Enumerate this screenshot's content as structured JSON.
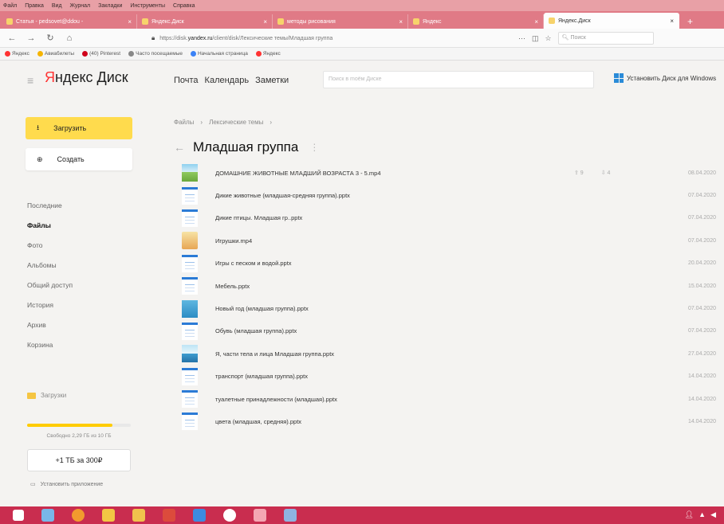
{
  "browser": {
    "menu": [
      "Файл",
      "Правка",
      "Вид",
      "Журнал",
      "Закладки",
      "Инструменты",
      "Справка"
    ],
    "tabs": [
      {
        "title": "Статья - pedsovet@ddou - ",
        "active": false
      },
      {
        "title": "Яндекс.Диск",
        "active": false
      },
      {
        "title": "методы рисования ",
        "active": false
      },
      {
        "title": "Яндекс",
        "active": false
      },
      {
        "title": "Яндекс.Диск",
        "active": true
      }
    ],
    "url_prefix": "https://disk.",
    "url_domain": "yandex.ru",
    "url_path": "/client/disk/Лексические темы/Младшая группа",
    "search_placeholder": "Поиск",
    "bookmarks": [
      "Яндекс",
      "Авиабилеты",
      "(40) Pinterest",
      "Часто посещаемые",
      "Начальная страница",
      "Яндекс"
    ]
  },
  "yandex": {
    "logo_red": "Я",
    "logo_rest": "ндекс Диск",
    "nav": [
      "Почта",
      "Календарь",
      "Заметки"
    ],
    "search_placeholder": "Поиск в moём Диске",
    "install_label": "Установить Диск для Windows"
  },
  "sidebar": {
    "upload": "Загрузить",
    "create": "Создать",
    "items": [
      "Последние",
      "Файлы",
      "Фото",
      "Альбомы",
      "Общий доступ",
      "История",
      "Архив",
      "Корзина"
    ],
    "active": "Файлы",
    "downloads": "Загрузки",
    "storage_fraction": 0.82,
    "storage_text": "Свободно 2,29 ГБ из 10 ГБ",
    "buy": "+1 ТБ за 300₽",
    "install_app": "Установить приложение"
  },
  "breadcrumb": [
    "Файлы",
    "Лексические темы"
  ],
  "page_title": "Младшая группа",
  "files": [
    {
      "name": "ДОМАШНИЕ ЖИВОТНЫЕ МЛАДШИЙ ВОЗРАСТА 3 - 5.mp4",
      "date": "08.04.2020",
      "thumb": "img-a",
      "meta": [
        "⇪ 9",
        "⇩ 4"
      ]
    },
    {
      "name": "Дикие животные (младшая-средняя группа).pptx",
      "date": "07.04.2020",
      "thumb": "doc"
    },
    {
      "name": "Дикие птицы. Младшая гр..pptx",
      "date": "07.04.2020",
      "thumb": "doc"
    },
    {
      "name": "Игрушки.mp4",
      "date": "07.04.2020",
      "thumb": "img-b"
    },
    {
      "name": "Игры с песком и водой.pptx",
      "date": "20.04.2020",
      "thumb": "doc"
    },
    {
      "name": "Мебель.pptx",
      "date": "15.04.2020",
      "thumb": "doc"
    },
    {
      "name": "Новый год (младшая группа).pptx",
      "date": "07.04.2020",
      "thumb": "img-c"
    },
    {
      "name": "Обувь (младшая группа).pptx",
      "date": "07.04.2020",
      "thumb": "doc"
    },
    {
      "name": "Я, части тела и лица Младшая группа.pptx",
      "date": "27.04.2020",
      "thumb": "img-d"
    },
    {
      "name": "транспорт (младшая группа).pptx",
      "date": "14.04.2020",
      "thumb": "doc"
    },
    {
      "name": "туалетные принадлежности (младшая).pptx",
      "date": "14.04.2020",
      "thumb": "doc"
    },
    {
      "name": "цвета (младшая, средняя).pptx",
      "date": "14.04.2020",
      "thumb": "doc"
    }
  ],
  "colors": {
    "accent": "#ffdb4d",
    "taskbar": "#c92d4f",
    "tabstrip": "#e07a86"
  }
}
